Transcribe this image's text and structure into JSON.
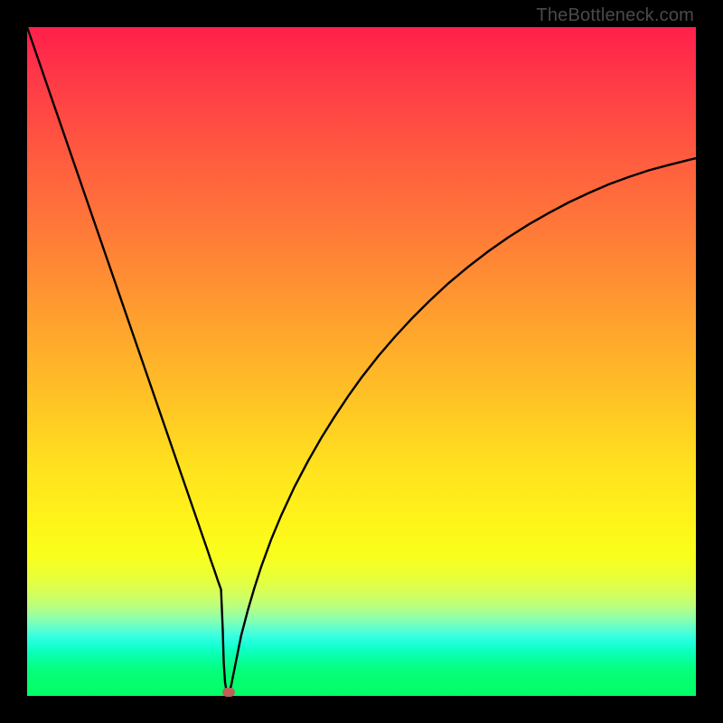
{
  "attribution": "TheBottleneck.com",
  "chart_data": {
    "type": "line",
    "title": "",
    "xlabel": "",
    "ylabel": "",
    "xlim": [
      0,
      100
    ],
    "ylim": [
      0,
      100
    ],
    "x": [
      0,
      2,
      4,
      6,
      8,
      10,
      12,
      14,
      16,
      18,
      20,
      21,
      22,
      23,
      24,
      25,
      26,
      27,
      27.5,
      28,
      28.5,
      29,
      29.25,
      29.4,
      29.6,
      29.8,
      30,
      30.2,
      30.5,
      31,
      32,
      33,
      34,
      35,
      36.5,
      38,
      40,
      42,
      44,
      46,
      48,
      50,
      52.5,
      55,
      57.5,
      60,
      63,
      66,
      69,
      72,
      75,
      78,
      81,
      84,
      87,
      90,
      93,
      96,
      100
    ],
    "values": [
      100,
      94.2,
      88.4,
      82.6,
      76.8,
      71,
      65.2,
      59.4,
      53.6,
      47.8,
      42,
      39.1,
      36.2,
      33.3,
      30.4,
      27.5,
      24.6,
      21.7,
      20.2,
      18.8,
      17.3,
      15.9,
      10,
      5,
      2,
      0.8,
      0.3,
      0.5,
      1.5,
      4,
      9,
      12.8,
      16.2,
      19.3,
      23.4,
      27,
      31.3,
      35.1,
      38.6,
      41.8,
      44.8,
      47.6,
      50.8,
      53.7,
      56.4,
      58.9,
      61.7,
      64.2,
      66.5,
      68.6,
      70.5,
      72.2,
      73.8,
      75.2,
      76.5,
      77.6,
      78.6,
      79.4,
      80.4
    ],
    "marker": {
      "x": 30.2,
      "y": 0.6,
      "color": "#c06058"
    }
  },
  "colors": {
    "curve": "#000000",
    "marker": "#c06058",
    "frame": "#000000"
  }
}
